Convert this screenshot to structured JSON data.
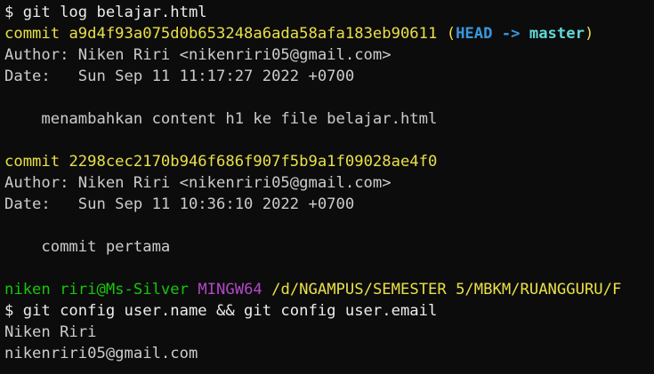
{
  "colors": {
    "background": "#0c0c0c",
    "text": "#cccccc",
    "commit_hash": "#e8e048",
    "head_ref": "#3a96dd",
    "branch_ref": "#61d6d6",
    "prompt_user": "#16c60c",
    "prompt_env": "#b148c6",
    "prompt_path": "#e8e048"
  },
  "lines": {
    "cmd1": "$ git log belajar.html",
    "c1_label": "commit ",
    "c1_hash": "a9d4f93a075d0b653248a6ada58afa183eb90611",
    "c1_open": " (",
    "c1_head": "HEAD -> ",
    "c1_branch": "master",
    "c1_close": ")",
    "c1_author": "Author: Niken Riri <nikenriri05@gmail.com>",
    "c1_date": "Date:   Sun Sep 11 11:17:27 2022 +0700",
    "c1_message": "    menambahkan content h1 ke file belajar.html",
    "c2_label": "commit ",
    "c2_hash": "2298cec2170b946f686f907f5b9a1f09028ae4f0",
    "c2_author": "Author: Niken Riri <nikenriri05@gmail.com>",
    "c2_date": "Date:   Sun Sep 11 10:36:10 2022 +0700",
    "c2_message": "    commit pertama",
    "prompt_user": "niken riri@Ms-Silver",
    "prompt_env": "MINGW64",
    "prompt_path": "/d/NGAMPUS/SEMESTER 5/MBKM/RUANGGURU/F",
    "cmd2": "$ git config user.name && git config user.email",
    "out_name": "Niken Riri",
    "out_email": "nikenriri05@gmail.com"
  }
}
